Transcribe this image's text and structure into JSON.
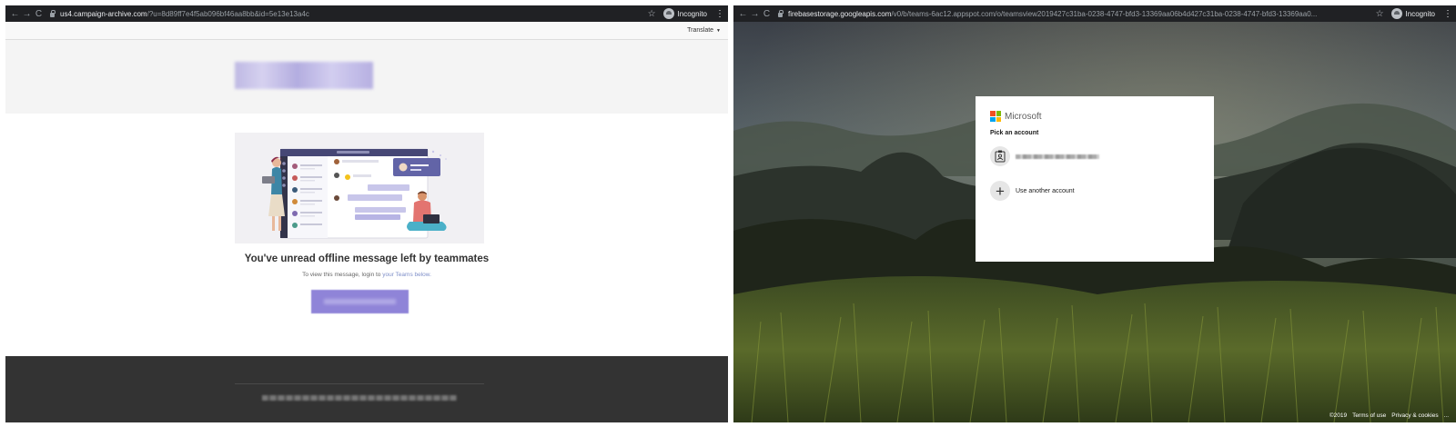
{
  "left_window": {
    "url_host": "us4.campaign-archive.com",
    "url_path": "/?u=8d89ff7e4f5ab096bf46aa8bb&id=5e13e13a4c",
    "incognito_label": "Incognito",
    "translate_label": "Translate",
    "headline": "You've unread offline message left by teammates",
    "subtext_prefix": "To view this message, login to ",
    "subtext_link": "your Teams below."
  },
  "right_window": {
    "url_host": "firebasestorage.googleapis.com",
    "url_path": "/v0/b/teams-6ac12.appspot.com/o/teamsview2019427c31ba-0238-4747-bfd3-13369aa06b4d427c31ba-0238-4747-bfd3-13369aa0...",
    "incognito_label": "Incognito",
    "brand_name": "Microsoft",
    "card_title": "Pick an account",
    "add_account_label": "Use another account",
    "footer": {
      "copyright": "©2019",
      "terms": "Terms of use",
      "privacy": "Privacy & cookies",
      "more": "..."
    }
  },
  "icons": {
    "back": "←",
    "forward": "→",
    "reload": "C",
    "star": "☆",
    "kebab": "⋮",
    "caret": "▼",
    "plus": "+"
  },
  "colors": {
    "teams_purple": "#6264a7",
    "ms_red": "#f25022",
    "ms_green": "#7fba00",
    "ms_blue": "#00a4ef",
    "ms_yellow": "#ffb900"
  }
}
